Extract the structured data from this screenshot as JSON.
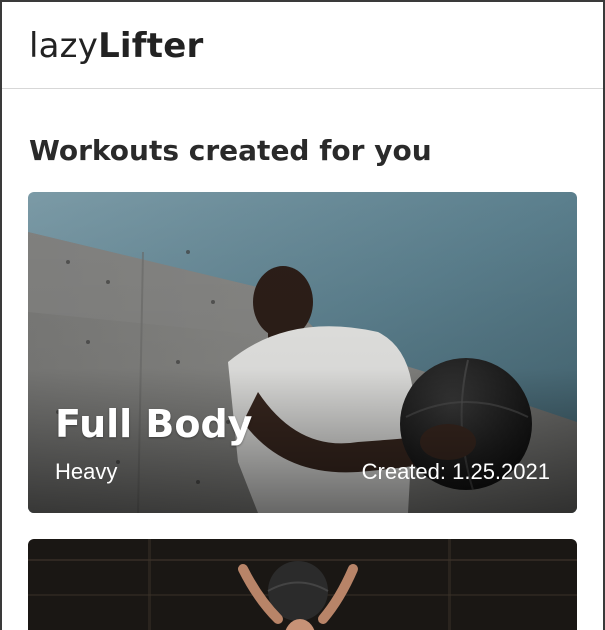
{
  "app": {
    "logo_light": "lazy",
    "logo_bold": "Lifter"
  },
  "main": {
    "section_title": "Workouts created for you",
    "workouts": [
      {
        "title": "Full Body",
        "level": "Heavy",
        "created": "Created: 1.25.2021"
      }
    ]
  }
}
